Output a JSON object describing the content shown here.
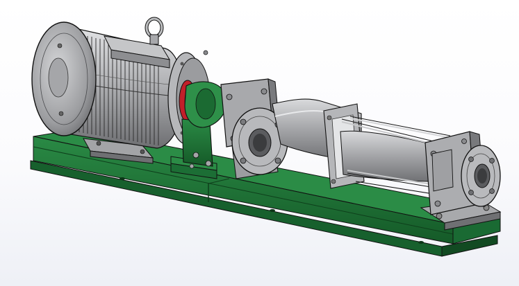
{
  "scene": {
    "subject": "pump-assembly-3d-model",
    "colors": {
      "base_frame": "#1e6b34",
      "base_frame_dark": "#124a22",
      "metal": "#a9aaad",
      "metal_light": "#d8d9db",
      "metal_dark": "#6f7073",
      "coupling_ring": "#c2202a",
      "outline": "#1a1a1a"
    }
  }
}
